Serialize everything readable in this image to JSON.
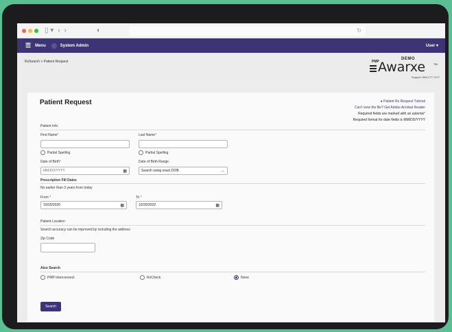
{
  "nav": {
    "menu": "Menu",
    "system_admin": "System Admin",
    "user": "User"
  },
  "breadcrumb": "RxSearch > Patient Request",
  "logo": {
    "pmp": "PMP",
    "demo": "DEMO",
    "name": "Awarxe",
    "tm": "TM",
    "support": "Support: 866-277-7477"
  },
  "page": {
    "title": "Patient Request"
  },
  "links": {
    "tutorial": "Patient Rx Request Tutorial",
    "acrobat": "Can't view the file? Get Adobe Acrobat Reader"
  },
  "notes": {
    "required": "Required fields are marked with an asterisk",
    "date_format": "Required format for date fields is MM/DD/YYYY"
  },
  "patient_info": {
    "section": "Patient Info",
    "first_name_label": "First Name",
    "last_name_label": "Last Name",
    "asterisk": "*",
    "first_name_value": "",
    "last_name_value": "",
    "partial_spelling": "Partial Spelling",
    "dob_label": "Date of Birth",
    "dob_placeholder": "MM/DD/YYYY",
    "dob_range_label": "Date of Birth Range",
    "dob_range_value": "Search using exact DOB"
  },
  "fill_dates": {
    "section": "Prescription Fill Dates",
    "note": "No earlier than 3 years from today",
    "from_label": "From",
    "from_value": "10/20/2020",
    "to_label": "To",
    "to_value": "10/20/2022"
  },
  "location": {
    "section": "Patient Location",
    "note": "Search accuracy can be improved by including the address",
    "zip_label": "Zip Code",
    "zip_value": ""
  },
  "also_search": {
    "section": "Also Search",
    "options": [
      "PMP Interconnect",
      "RxCheck",
      "None"
    ],
    "selected": "None"
  },
  "search_button": "Search"
}
